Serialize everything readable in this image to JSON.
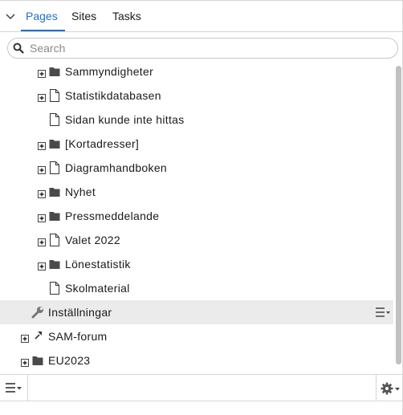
{
  "tabs": [
    {
      "label": "Pages",
      "active": true
    },
    {
      "label": "Sites",
      "active": false
    },
    {
      "label": "Tasks",
      "active": false
    }
  ],
  "search": {
    "placeholder": "Search",
    "value": ""
  },
  "tree": [
    {
      "label": "Sammyndigheter",
      "icon": "folder-icon",
      "expander": true
    },
    {
      "label": "Statistikdatabasen",
      "icon": "page-icon",
      "expander": true
    },
    {
      "label": "Sidan kunde inte hittas",
      "icon": "page-icon",
      "expander": false
    },
    {
      "label": "[Kortadresser]",
      "icon": "folder-icon",
      "expander": true
    },
    {
      "label": "Diagramhandboken",
      "icon": "page-icon",
      "expander": true
    },
    {
      "label": "Nyhet",
      "icon": "folder-icon",
      "expander": true
    },
    {
      "label": "Pressmeddelande",
      "icon": "folder-icon",
      "expander": true
    },
    {
      "label": "Valet 2022",
      "icon": "page-icon",
      "expander": true
    },
    {
      "label": "Lönestatistik",
      "icon": "folder-icon",
      "expander": true
    },
    {
      "label": "Skolmaterial",
      "icon": "page-icon",
      "expander": false
    },
    {
      "label": "Inställningar",
      "icon": "wrench-icon",
      "expander": false,
      "selected": true
    },
    {
      "label": "SAM-forum",
      "icon": "site-icon",
      "expander": true
    },
    {
      "label": "EU2023",
      "icon": "folder-icon",
      "expander": true
    }
  ],
  "colors": {
    "accent": "#1e6fd0",
    "selected_row": "#ebebeb",
    "icon_dark": "#4a4a4a"
  }
}
